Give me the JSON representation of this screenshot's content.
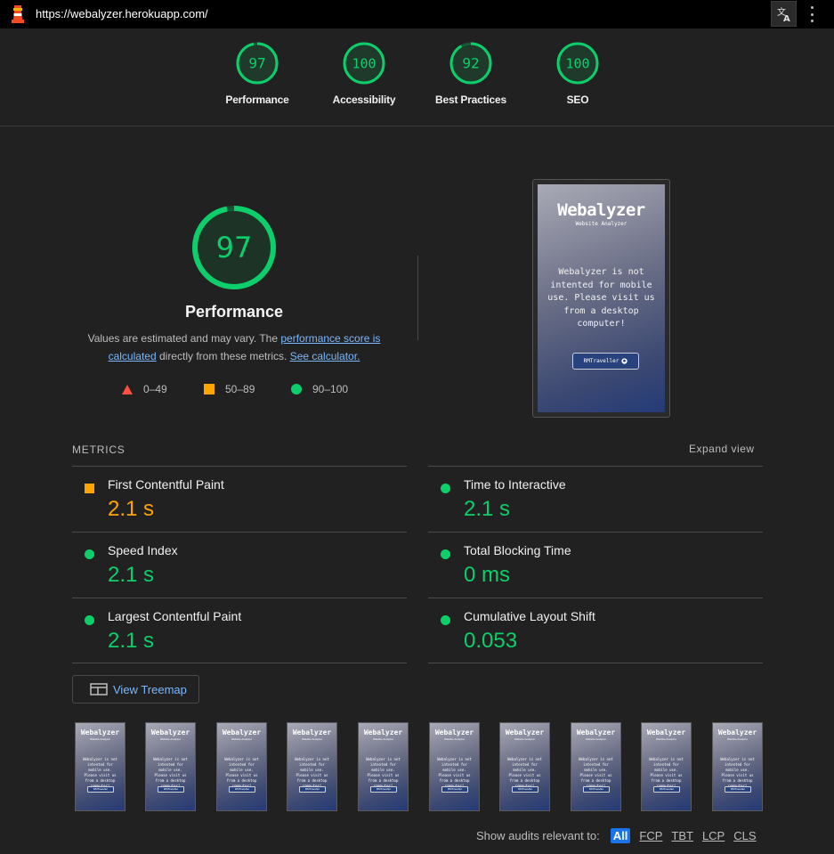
{
  "browser": {
    "url": "https://webalyzer.herokuapp.com/"
  },
  "categories": [
    {
      "name": "Performance",
      "score": "97"
    },
    {
      "name": "Accessibility",
      "score": "100"
    },
    {
      "name": "Best Practices",
      "score": "92"
    },
    {
      "name": "SEO",
      "score": "100"
    }
  ],
  "performance": {
    "score": "97",
    "title": "Performance",
    "desc_prefix": "Values are estimated and may vary. The ",
    "desc_link1": "performance score is calculated",
    "desc_middle": " directly from these metrics. ",
    "desc_link2": "See calculator.",
    "legend": [
      {
        "range": "0–49",
        "shape": "triangle",
        "color": "#ff4e42"
      },
      {
        "range": "50–89",
        "shape": "square",
        "color": "#ffa400"
      },
      {
        "range": "90–100",
        "shape": "circle",
        "color": "#0cce6b"
      }
    ]
  },
  "screenshot": {
    "title": "Webalyzer",
    "subtitle": "Website Analyzer",
    "message": "Webalyzer is not intented for mobile use. Please visit us from a desktop computer!",
    "button": "RMTraveller"
  },
  "metrics": {
    "heading": "METRICS",
    "expand_label": "Expand view",
    "items": [
      {
        "name": "First Contentful Paint",
        "value": "2.1 s",
        "rating": "average"
      },
      {
        "name": "Time to Interactive",
        "value": "2.1 s",
        "rating": "pass"
      },
      {
        "name": "Speed Index",
        "value": "2.1 s",
        "rating": "pass"
      },
      {
        "name": "Total Blocking Time",
        "value": "0 ms",
        "rating": "pass"
      },
      {
        "name": "Largest Contentful Paint",
        "value": "2.1 s",
        "rating": "pass"
      },
      {
        "name": "Cumulative Layout Shift",
        "value": "0.053",
        "rating": "pass"
      }
    ]
  },
  "treemap": {
    "label": "View Treemap"
  },
  "filmstrip": {
    "count": 10
  },
  "filter": {
    "label": "Show audits relevant to:",
    "options": [
      "All",
      "FCP",
      "TBT",
      "LCP",
      "CLS"
    ],
    "active": "All"
  },
  "colors": {
    "pass": "#0cce6b",
    "average": "#ffa400",
    "fail": "#ff4e42",
    "link": "#7ab8ff",
    "accent": "#1a73e8"
  }
}
